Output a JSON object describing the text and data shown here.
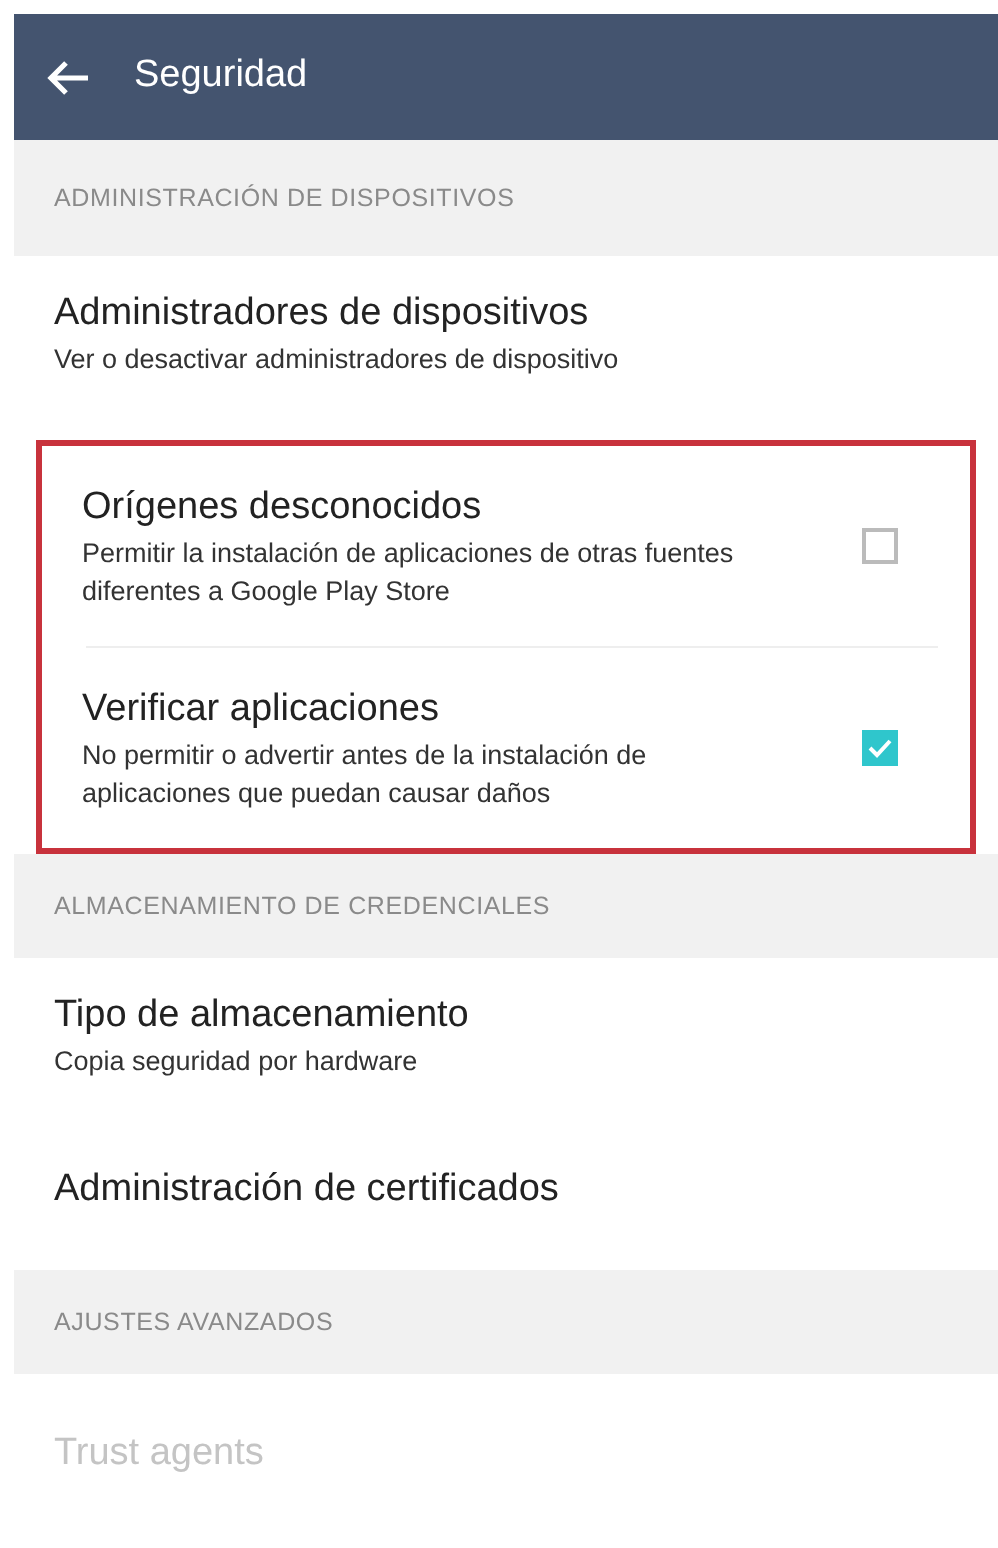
{
  "app_bar": {
    "title": "Seguridad"
  },
  "sections": [
    {
      "header": "ADMINISTRACIÓN DE DISPOSITIVOS",
      "items": [
        {
          "kind": "plain",
          "title": "Administradores de dispositivos",
          "summary": "Ver o desactivar administradores de dispositivo",
          "highlighted": false,
          "disabled": false
        },
        {
          "kind": "checkbox",
          "title": "Orígenes desconocidos",
          "summary": "Permitir la instalación de aplicaciones de otras fuentes diferentes a Google Play Store",
          "checked": false,
          "highlighted": true,
          "disabled": false
        },
        {
          "kind": "checkbox",
          "title": "Verificar aplicaciones",
          "summary": "No permitir o advertir antes de la instalación de aplicaciones que puedan causar daños",
          "checked": true,
          "highlighted": true,
          "disabled": false
        }
      ]
    },
    {
      "header": "ALMACENAMIENTO DE CREDENCIALES",
      "items": [
        {
          "kind": "plain",
          "title": "Tipo de almacenamiento",
          "summary": "Copia seguridad por hardware",
          "highlighted": false,
          "disabled": false
        },
        {
          "kind": "plain",
          "title": "Administración de certificados",
          "highlighted": false,
          "disabled": false
        }
      ]
    },
    {
      "header": "AJUSTES AVANZADOS",
      "items": [
        {
          "kind": "plain",
          "title": "Trust agents",
          "highlighted": false,
          "disabled": true
        }
      ]
    }
  ]
}
